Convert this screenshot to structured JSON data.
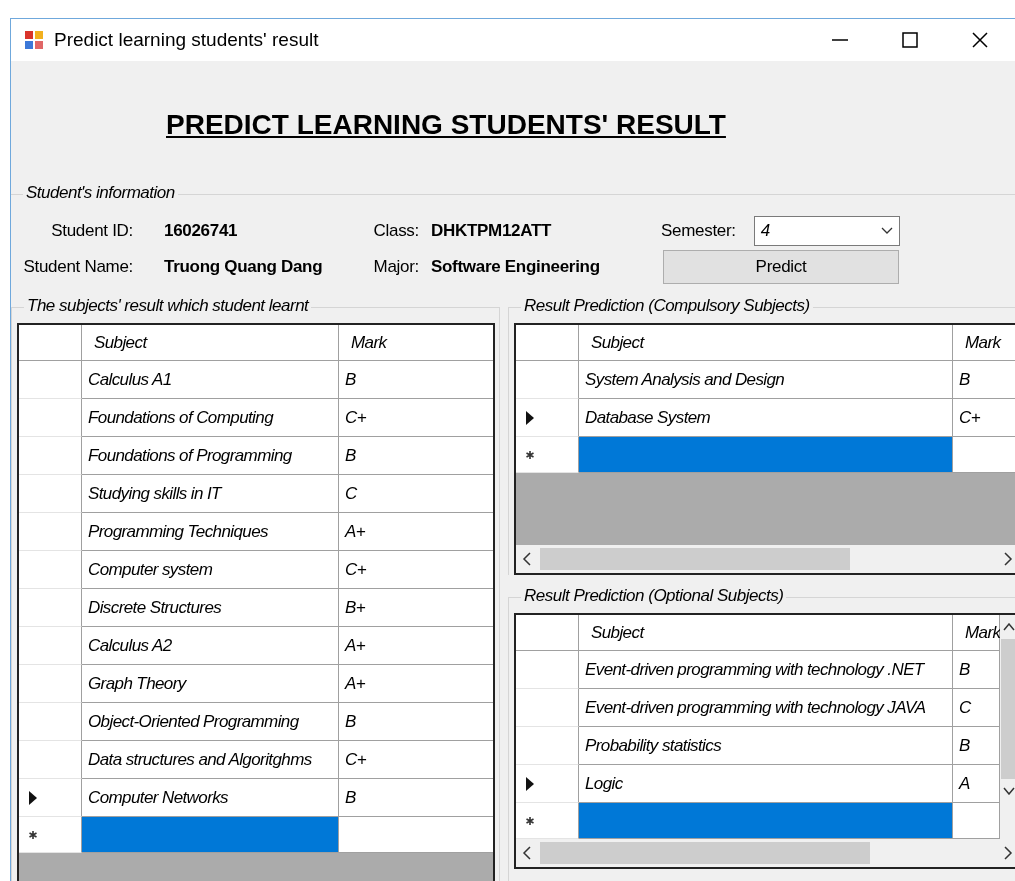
{
  "window": {
    "title": "Predict learning students' result"
  },
  "heading": "PREDICT LEARNING STUDENTS' RESULT",
  "student_info": {
    "legend": "Student's information",
    "fields": [
      {
        "label": "Student ID:",
        "value": "16026741"
      },
      {
        "label": "Class:",
        "value": "DHKTPM12ATT"
      },
      {
        "label": "Student Name:",
        "value": "Truong Quang Dang"
      },
      {
        "label": "Major:",
        "value": "Software Engineering"
      }
    ],
    "semester": {
      "label": "Semester:",
      "value": "4"
    },
    "predict_button": "Predict"
  },
  "learnt": {
    "legend": "The subjects' result which student learnt",
    "columns": [
      "Subject",
      "Mark"
    ],
    "rows": [
      {
        "kind": "data",
        "subject": "Calculus A1",
        "mark": "B",
        "current": false,
        "selected": false
      },
      {
        "kind": "data",
        "subject": "Foundations of Computing",
        "mark": "C+",
        "current": false,
        "selected": false
      },
      {
        "kind": "data",
        "subject": "Foundations of Programming",
        "mark": "B",
        "current": false,
        "selected": false
      },
      {
        "kind": "data",
        "subject": "Studying skills in IT",
        "mark": "C",
        "current": false,
        "selected": false
      },
      {
        "kind": "data",
        "subject": "Programming Techniques",
        "mark": "A+",
        "current": false,
        "selected": false
      },
      {
        "kind": "data",
        "subject": "Computer system",
        "mark": "C+",
        "current": false,
        "selected": false
      },
      {
        "kind": "data",
        "subject": "Discrete Structures",
        "mark": "B+",
        "current": false,
        "selected": false
      },
      {
        "kind": "data",
        "subject": "Calculus A2",
        "mark": "A+",
        "current": false,
        "selected": false
      },
      {
        "kind": "data",
        "subject": "Graph Theory",
        "mark": "A+",
        "current": false,
        "selected": false
      },
      {
        "kind": "data",
        "subject": "Object-Oriented Programming",
        "mark": "B",
        "current": false,
        "selected": false
      },
      {
        "kind": "data",
        "subject": "Data structures and Algoritghms",
        "mark": "C+",
        "current": false,
        "selected": false
      },
      {
        "kind": "data",
        "subject": "Computer Networks",
        "mark": "B",
        "current": true,
        "selected": false
      },
      {
        "kind": "new",
        "current": false,
        "selected": true
      }
    ]
  },
  "compulsory": {
    "legend": "Result Prediction (Compulsory Subjects)",
    "columns": [
      "Subject",
      "Mark"
    ],
    "rows": [
      {
        "kind": "data",
        "subject": "System Analysis and Design",
        "mark": "B",
        "current": false,
        "selected": false
      },
      {
        "kind": "data",
        "subject": "Database System",
        "mark": "C+",
        "current": true,
        "selected": false
      },
      {
        "kind": "new",
        "current": false,
        "selected": true
      }
    ]
  },
  "optional": {
    "legend": "Result Prediction (Optional Subjects)",
    "columns": [
      "Subject",
      "Mark"
    ],
    "rows": [
      {
        "kind": "data",
        "subject": "Event-driven programming with technology .NET",
        "mark": "B",
        "current": false,
        "selected": false
      },
      {
        "kind": "data",
        "subject": "Event-driven programming with technology JAVA",
        "mark": "C",
        "current": false,
        "selected": false
      },
      {
        "kind": "data",
        "subject": "Probability statistics",
        "mark": "B",
        "current": false,
        "selected": false
      },
      {
        "kind": "data",
        "subject": "Logic",
        "mark": "A",
        "current": true,
        "selected": false
      },
      {
        "kind": "new",
        "current": false,
        "selected": true
      }
    ]
  }
}
